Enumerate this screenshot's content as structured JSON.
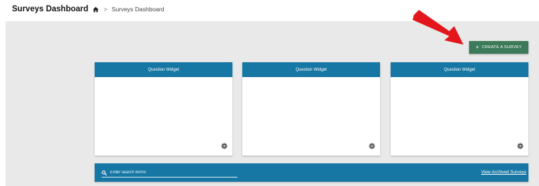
{
  "header": {
    "title": "Surveys Dashboard",
    "breadcrumb": {
      "home_icon": "home-icon",
      "separator": ">",
      "current": "Surveys Dashboard"
    }
  },
  "actions": {
    "create_label": "CREATE A SURVEY",
    "create_icon": "+"
  },
  "widgets": [
    {
      "title": "Question Widget",
      "icon": "gear-icon"
    },
    {
      "title": "Question Widget",
      "icon": "gear-icon"
    },
    {
      "title": "Question Widget",
      "icon": "gear-icon"
    }
  ],
  "search": {
    "placeholder": "Enter search terms",
    "value": "",
    "archived_link": "View Archived Surveys"
  },
  "colors": {
    "accent": "#1677a5",
    "create_button": "#3d7a5a",
    "annotation_arrow": "#e3161c",
    "content_background": "#e9e9e9"
  }
}
